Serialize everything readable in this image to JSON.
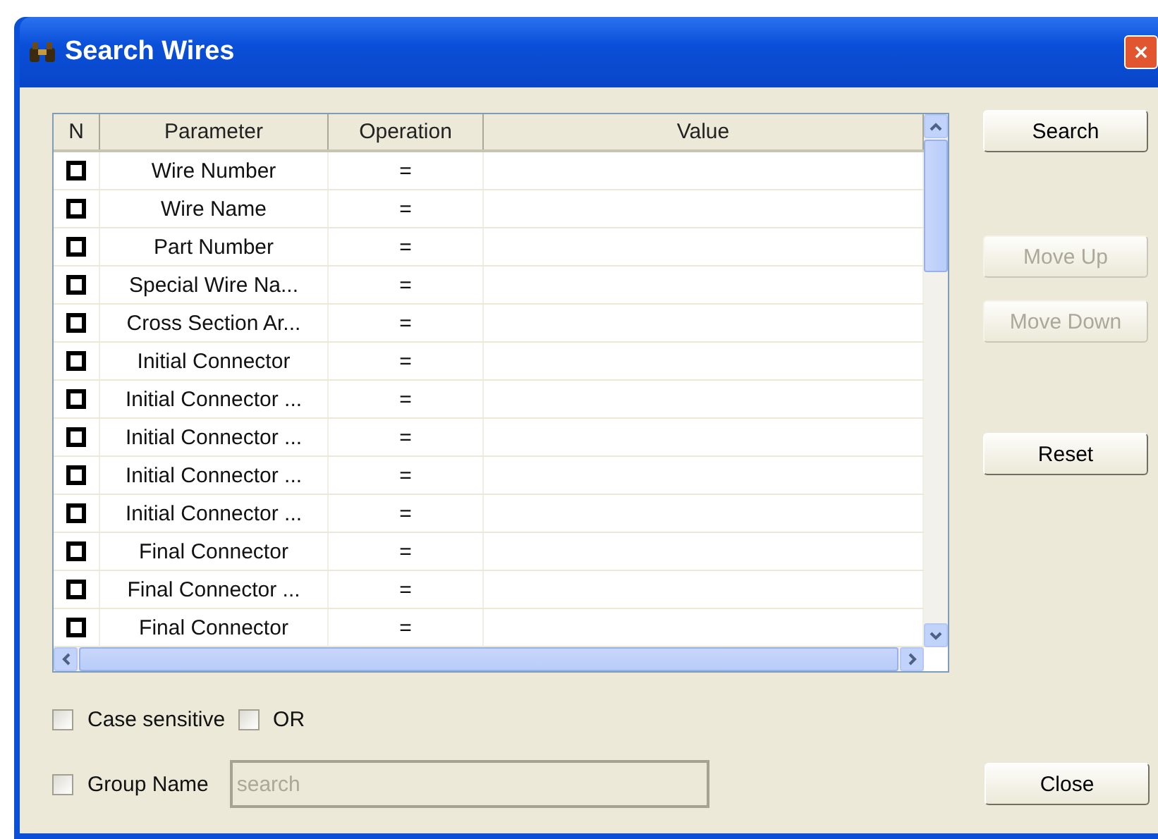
{
  "window": {
    "title": "Search Wires"
  },
  "table": {
    "columns": [
      "N",
      "Parameter",
      "Operation",
      "Value"
    ],
    "rows": [
      {
        "checked": false,
        "parameter": "Wire Number",
        "operation": "="
      },
      {
        "checked": false,
        "parameter": "Wire Name",
        "operation": "="
      },
      {
        "checked": false,
        "parameter": "Part Number",
        "operation": "="
      },
      {
        "checked": false,
        "parameter": "Special Wire Na...",
        "operation": "="
      },
      {
        "checked": false,
        "parameter": "Cross Section Ar...",
        "operation": "="
      },
      {
        "checked": false,
        "parameter": "Initial Connector",
        "operation": "="
      },
      {
        "checked": false,
        "parameter": "Initial Connector ...",
        "operation": "="
      },
      {
        "checked": false,
        "parameter": "Initial Connector ...",
        "operation": "="
      },
      {
        "checked": false,
        "parameter": "Initial Connector ...",
        "operation": "="
      },
      {
        "checked": false,
        "parameter": "Initial Connector ...",
        "operation": "="
      },
      {
        "checked": false,
        "parameter": "Final Connector",
        "operation": "="
      },
      {
        "checked": false,
        "parameter": "Final Connector ...",
        "operation": "="
      },
      {
        "checked": false,
        "parameter": "Final Connector",
        "operation": "="
      }
    ]
  },
  "buttons": [
    {
      "label": "Search",
      "disabled": false
    },
    {
      "label": "Move Up",
      "disabled": true
    },
    {
      "label": "Move Down",
      "disabled": true
    },
    {
      "label": "Reset",
      "disabled": false
    }
  ],
  "options": [
    {
      "label": "Case sensitive",
      "checked": false
    },
    {
      "label": "OR",
      "checked": false
    }
  ],
  "group_name": {
    "label": "Group Name",
    "checked": false,
    "value": "search",
    "disabled": true
  },
  "close_button": {
    "label": "Close"
  }
}
